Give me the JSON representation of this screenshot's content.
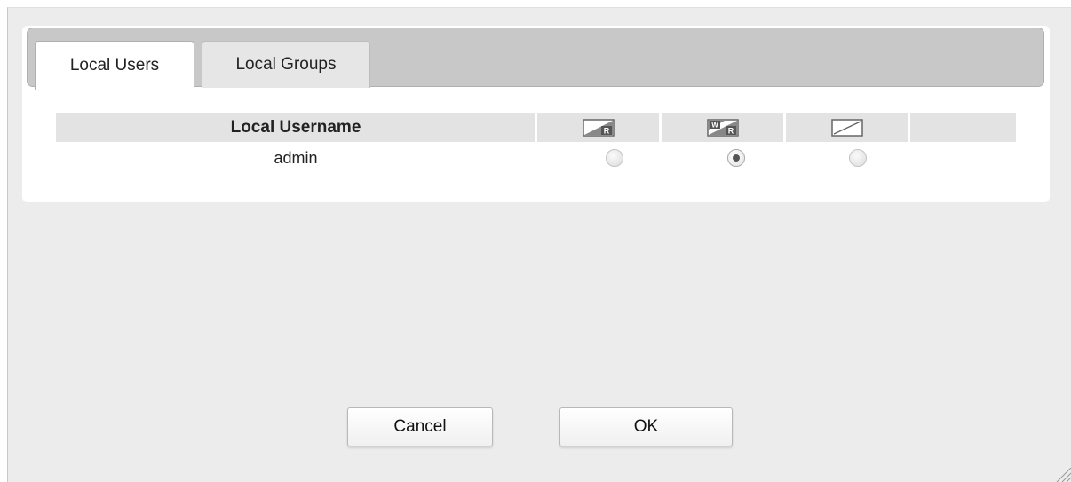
{
  "tabs": [
    {
      "label": "Local Users",
      "active": true
    },
    {
      "label": "Local Groups",
      "active": false
    }
  ],
  "table": {
    "column_header": "Local Username",
    "permission_icons": [
      "read-only-icon",
      "read-write-icon",
      "deny-access-icon"
    ],
    "rows": [
      {
        "username": "admin",
        "permission": "read-write"
      }
    ]
  },
  "buttons": {
    "cancel_label": "Cancel",
    "ok_label": "OK"
  }
}
